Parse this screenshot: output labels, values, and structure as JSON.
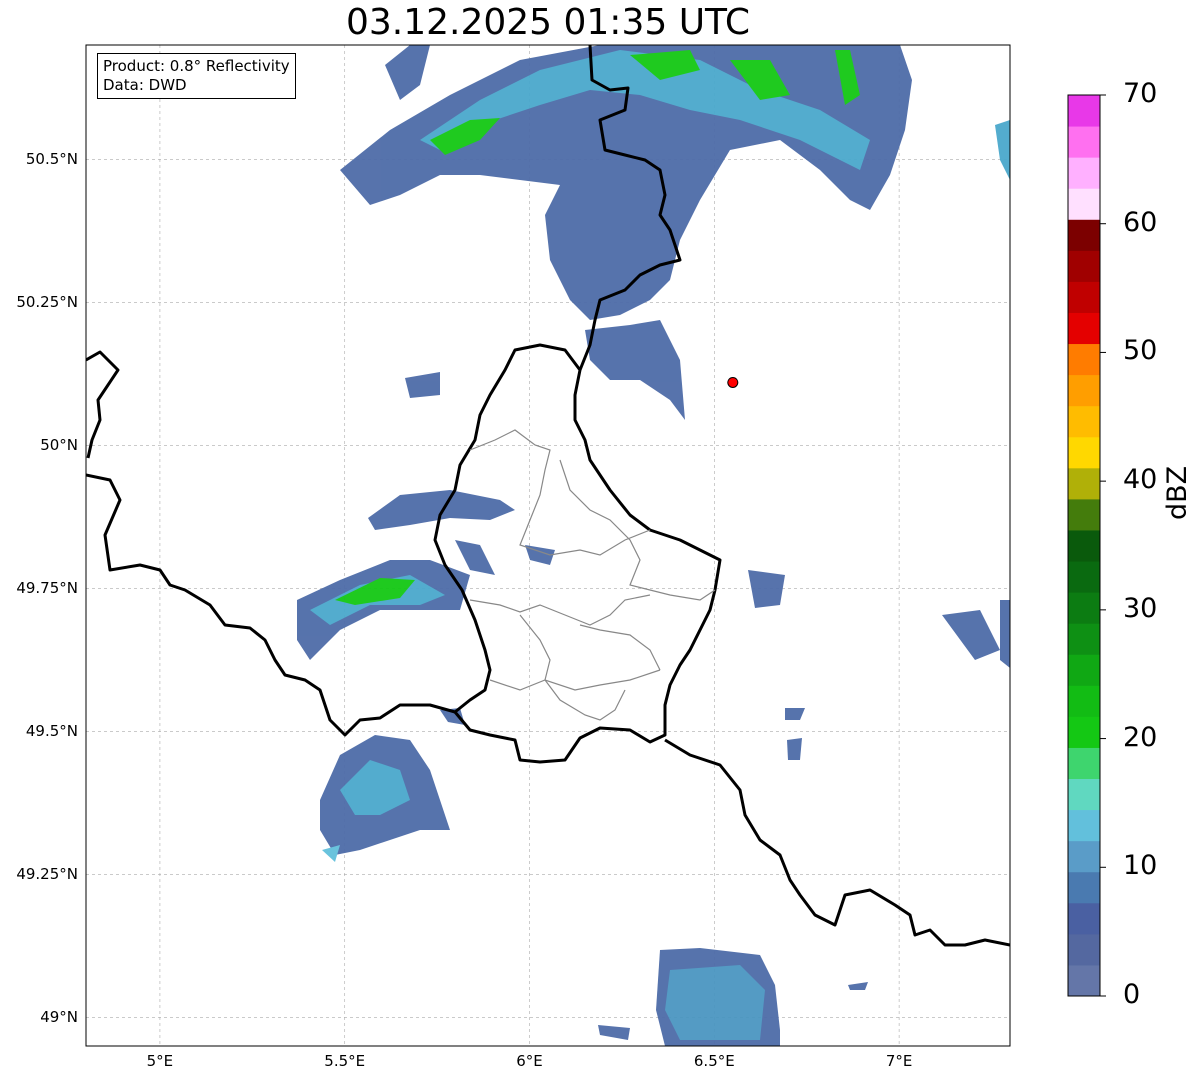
{
  "title": "03.12.2025 01:35 UTC",
  "info": {
    "product": "Product: 0.8° Reflectivity",
    "source": "Data: DWD"
  },
  "axes": {
    "lon_range": [
      4.8,
      7.3
    ],
    "lat_range": [
      48.95,
      50.7
    ],
    "x_ticks": [
      {
        "value": 5.0,
        "label": "5°E"
      },
      {
        "value": 5.5,
        "label": "5.5°E"
      },
      {
        "value": 6.0,
        "label": "6°E"
      },
      {
        "value": 6.5,
        "label": "6.5°E"
      },
      {
        "value": 7.0,
        "label": "7°E"
      }
    ],
    "y_ticks": [
      {
        "value": 50.5,
        "label": "50.5°N"
      },
      {
        "value": 50.25,
        "label": "50.25°N"
      },
      {
        "value": 50.0,
        "label": "50°N"
      },
      {
        "value": 49.75,
        "label": "49.75°N"
      },
      {
        "value": 49.5,
        "label": "49.5°N"
      },
      {
        "value": 49.25,
        "label": "49.25°N"
      },
      {
        "value": 49.0,
        "label": "49°N"
      }
    ],
    "grid": true
  },
  "radar_site": {
    "lon": 6.55,
    "lat": 50.11,
    "color": "#ff0000"
  },
  "colorbar": {
    "label": "dBZ",
    "min": 0,
    "max": 70,
    "tick_labels": [
      {
        "value": 0,
        "label": "0"
      },
      {
        "value": 10,
        "label": "10"
      },
      {
        "value": 20,
        "label": "20"
      },
      {
        "value": 30,
        "label": "30"
      },
      {
        "value": 40,
        "label": "40"
      },
      {
        "value": 50,
        "label": "50"
      },
      {
        "value": 60,
        "label": "60"
      },
      {
        "value": 70,
        "label": "70"
      }
    ],
    "colors": [
      "#6476a8",
      "#5468a0",
      "#4a60a2",
      "#4a7ab0",
      "#5a9cc8",
      "#62c0dc",
      "#60d8c0",
      "#3ed56e",
      "#14c814",
      "#12bc14",
      "#10a814",
      "#0e9014",
      "#0c7c12",
      "#0a6a10",
      "#0a5a0c",
      "#447c0c",
      "#b0b008",
      "#ffd800",
      "#ffbc00",
      "#ff9e00",
      "#ff7c00",
      "#e40000",
      "#c00000",
      "#a00000",
      "#7c0000",
      "#ffe0ff",
      "#ffb0ff",
      "#ff70f0",
      "#e838e8"
    ]
  },
  "echo_colors": {
    "low": "#4e6ca8",
    "mid": "#4aa8cc",
    "high": "#14c814"
  }
}
